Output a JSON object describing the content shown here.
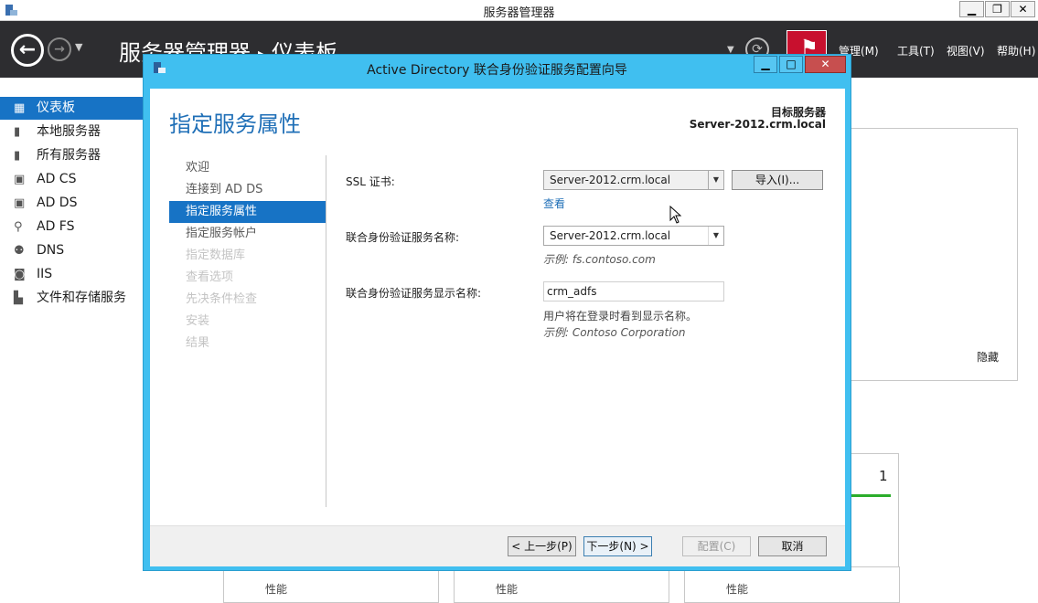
{
  "window": {
    "title": "服务器管理器",
    "controls": {
      "minimize": "▁",
      "restore": "❐",
      "close": "✕"
    }
  },
  "header": {
    "breadcrumb_root": "服务器管理器",
    "breadcrumb_sep": "▸",
    "breadcrumb_current": "仪表板",
    "menus": [
      "管理(M)",
      "工具(T)",
      "视图(V)",
      "帮助(H)"
    ]
  },
  "sidebar": {
    "items": [
      {
        "label": "仪表板",
        "icon": "dashboard-icon",
        "active": true
      },
      {
        "label": "本地服务器",
        "icon": "server-icon"
      },
      {
        "label": "所有服务器",
        "icon": "servers-icon"
      },
      {
        "label": "AD CS",
        "icon": "ad-cs-icon"
      },
      {
        "label": "AD DS",
        "icon": "ad-ds-icon"
      },
      {
        "label": "AD FS",
        "icon": "ad-fs-icon"
      },
      {
        "label": "DNS",
        "icon": "dns-icon"
      },
      {
        "label": "IIS",
        "icon": "iis-icon"
      },
      {
        "label": "文件和存储服务",
        "icon": "file-storage-icon"
      }
    ]
  },
  "background": {
    "hide_link": "隐藏",
    "count": "1",
    "perf_labels": [
      "性能",
      "性能",
      "性能"
    ]
  },
  "wizard": {
    "title": "Active Directory 联合身份验证服务配置向导",
    "heading": "指定服务属性",
    "target_label": "目标服务器",
    "target_value": "Server-2012.crm.local",
    "steps": [
      {
        "label": "欢迎",
        "state": "normal"
      },
      {
        "label": "连接到 AD DS",
        "state": "normal"
      },
      {
        "label": "指定服务属性",
        "state": "active"
      },
      {
        "label": "指定服务帐户",
        "state": "normal"
      },
      {
        "label": "指定数据库",
        "state": "disabled"
      },
      {
        "label": "查看选项",
        "state": "disabled"
      },
      {
        "label": "先决条件检查",
        "state": "disabled"
      },
      {
        "label": "安装",
        "state": "disabled"
      },
      {
        "label": "结果",
        "state": "disabled"
      }
    ],
    "ssl": {
      "label": "SSL 证书:",
      "value": "Server-2012.crm.local",
      "import_button": "导入(I)...",
      "view_link": "查看"
    },
    "service_name": {
      "label": "联合身份验证服务名称:",
      "value": "Server-2012.crm.local",
      "example": "示例: fs.contoso.com"
    },
    "display_name": {
      "label": "联合身份验证服务显示名称:",
      "value": "crm_adfs",
      "note": "用户将在登录时看到显示名称。",
      "example": "示例: Contoso Corporation"
    },
    "buttons": {
      "prev": "< 上一步(P)",
      "next": "下一步(N) >",
      "configure": "配置(C)",
      "cancel": "取消"
    }
  },
  "colors": {
    "header_bg": "#2d2d30",
    "accent": "#1773c5",
    "wizard_frame": "#40bff0",
    "heading_text": "#1f6fb7",
    "flag": "#c8102e"
  }
}
